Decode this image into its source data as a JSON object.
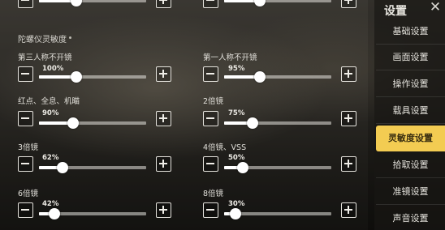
{
  "sidebar": {
    "title": "设置",
    "close_icon": "close-icon",
    "items": [
      {
        "label": "基础设置",
        "active": false
      },
      {
        "label": "画面设置",
        "active": false
      },
      {
        "label": "操作设置",
        "active": false
      },
      {
        "label": "载具设置",
        "active": false
      },
      {
        "label": "灵敏度设置",
        "active": true
      },
      {
        "label": "拾取设置",
        "active": false
      },
      {
        "label": "准镜设置",
        "active": false
      },
      {
        "label": "声音设置",
        "active": false
      }
    ]
  },
  "section": {
    "title": "陀螺仪灵敏度"
  },
  "settings": [
    {
      "label": "第三人称不开镜",
      "percent": "100%",
      "value_percent": 100
    },
    {
      "label": "第一人称不开镜",
      "percent": "95%",
      "value_percent": 95
    },
    {
      "label": "红点、全息、机瞄",
      "percent": "90%",
      "value_percent": 90
    },
    {
      "label": "2倍镜",
      "percent": "75%",
      "value_percent": 75
    },
    {
      "label": "3倍镜",
      "percent": "62%",
      "value_percent": 62
    },
    {
      "label": "4倍镜、VSS",
      "percent": "50%",
      "value_percent": 50
    },
    {
      "label": "6倍镜",
      "percent": "42%",
      "value_percent": 42
    },
    {
      "label": "8倍镜",
      "percent": "30%",
      "value_percent": 30
    }
  ],
  "top_partial_row": {
    "left_value_percent": 100,
    "right_value_percent": 95
  },
  "colors": {
    "accent": "#f3cc52",
    "text": "#e2e0da",
    "slider_track": "#a8a6a0",
    "slider_fill": "#ffffff"
  }
}
